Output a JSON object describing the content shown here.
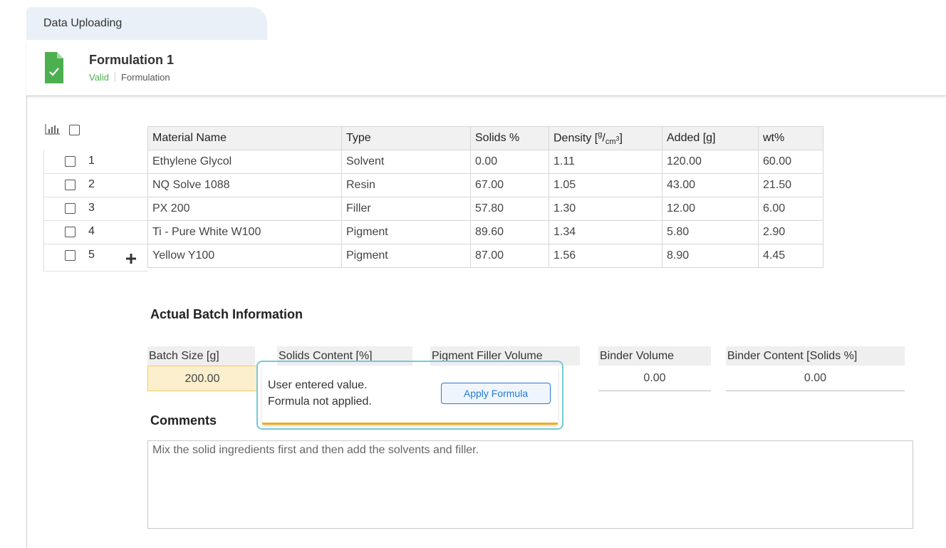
{
  "tab": {
    "label": "Data Uploading"
  },
  "header": {
    "title": "Formulation 1",
    "status": "Valid",
    "type": "Formulation",
    "icon": "file-check-icon"
  },
  "colors": {
    "valid": "#4caf50",
    "link": "#2a7ad5",
    "tooltip_border": "#74cad6",
    "tooltip_accent": "#f0ad1c",
    "highlight": "#fcefcd"
  },
  "table": {
    "columns": [
      "Material Name",
      "Type",
      "Solids %",
      "Density",
      "Added [g]",
      "wt%"
    ],
    "density_unit": {
      "num": "g",
      "den": "cm",
      "exp": "3"
    },
    "rows": [
      {
        "num": "1",
        "name": "Ethylene Glycol",
        "type": "Solvent",
        "solids": "0.00",
        "density": "1.11",
        "added": "120.00",
        "wt": "60.00"
      },
      {
        "num": "2",
        "name": "NQ Solve 1088",
        "type": "Resin",
        "solids": "67.00",
        "density": "1.05",
        "added": "43.00",
        "wt": "21.50"
      },
      {
        "num": "3",
        "name": "PX 200",
        "type": "Filler",
        "solids": "57.80",
        "density": "1.30",
        "added": "12.00",
        "wt": "6.00"
      },
      {
        "num": "4",
        "name": "Ti - Pure White W100",
        "type": "Pigment",
        "solids": "89.60",
        "density": "1.34",
        "added": "5.80",
        "wt": "2.90"
      },
      {
        "num": "5",
        "name": "Yellow Y100",
        "type": "Pigment",
        "solids": "87.00",
        "density": "1.56",
        "added": "8.90",
        "wt": "4.45"
      }
    ]
  },
  "batch": {
    "title": "Actual Batch Information",
    "labels": [
      "Batch Size [g]",
      "Solids Content [%]",
      "Pigment Filler Volume",
      "Binder Volume",
      "Binder Content [Solids %]"
    ],
    "values": {
      "batch_size": "200.00",
      "binder_volume": "0.00",
      "binder_content": "0.00"
    }
  },
  "tooltip": {
    "line1": "User entered value.",
    "line2": "Formula not applied.",
    "button": "Apply Formula"
  },
  "comments": {
    "title": "Comments",
    "text": "Mix the solid ingredients first and then add the solvents and filler."
  }
}
